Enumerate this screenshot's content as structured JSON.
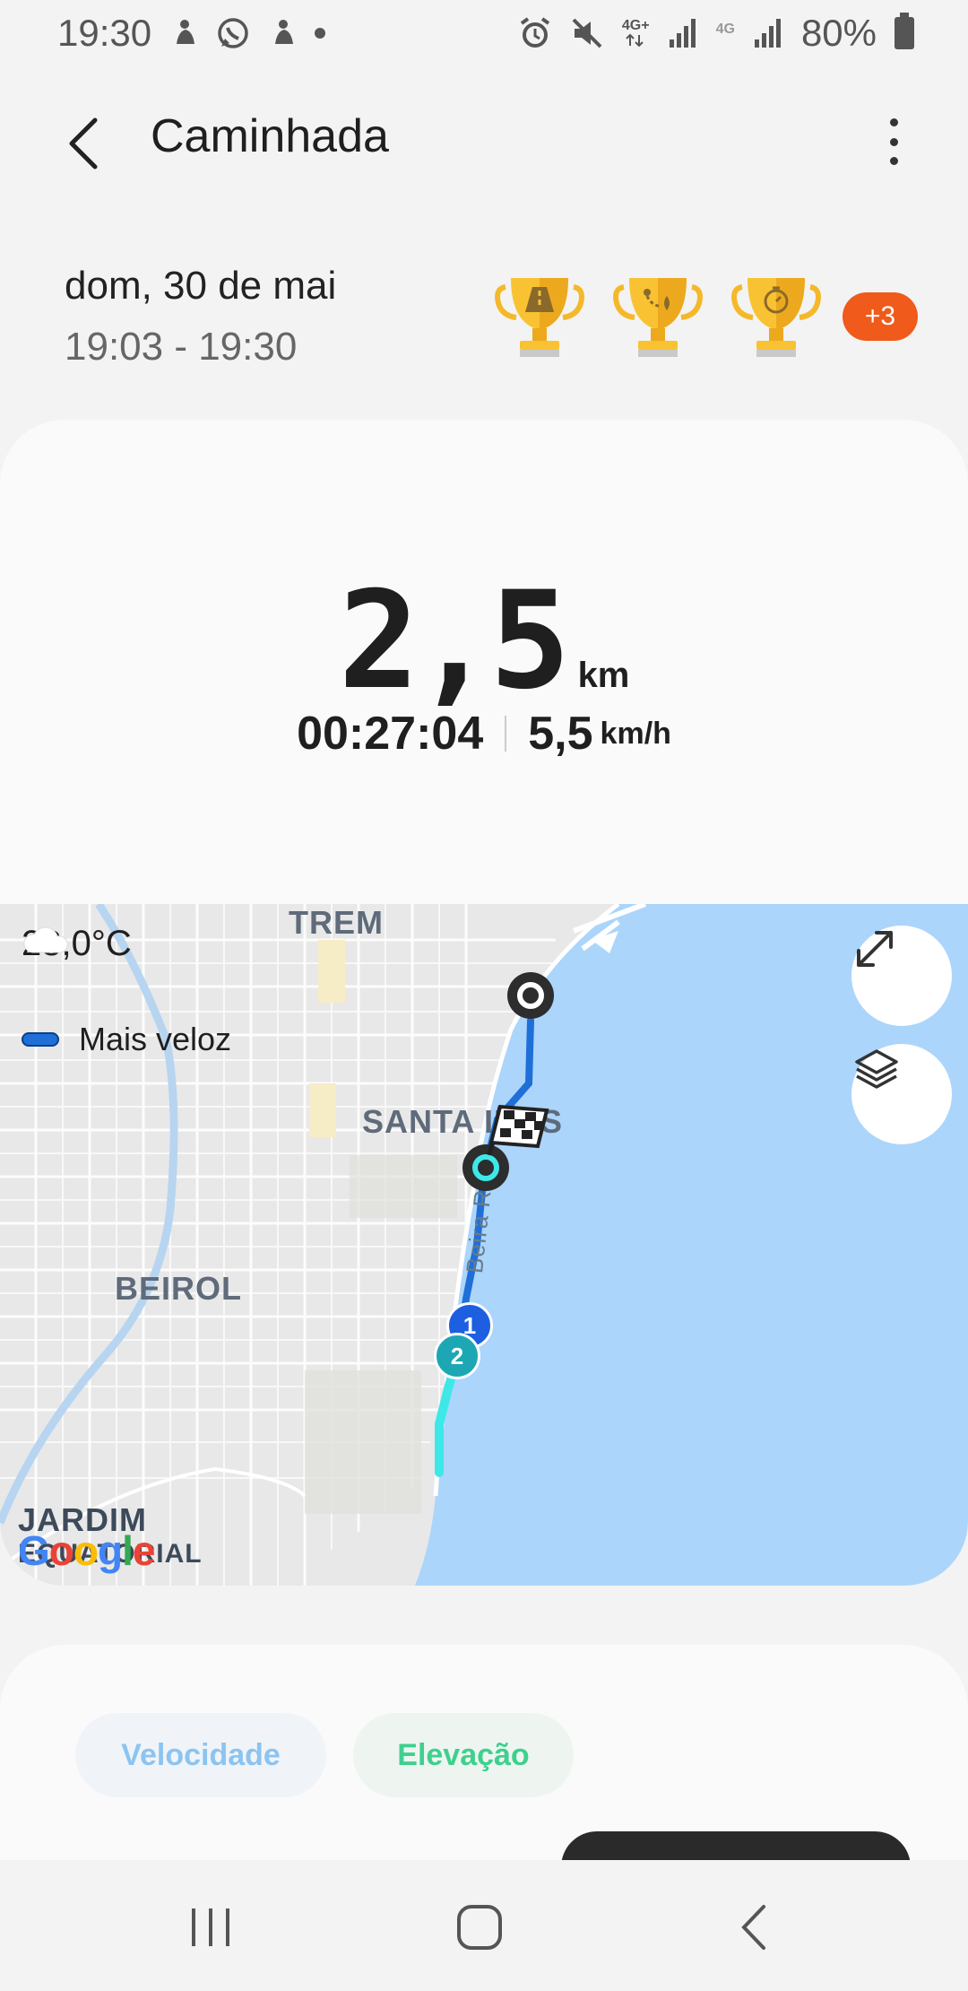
{
  "status_bar": {
    "time": "19:30",
    "network_1": "4G+",
    "network_2": "4G",
    "battery": "80%",
    "icons": [
      "notification-icon",
      "whatsapp-icon",
      "notification-icon",
      "dot-icon",
      "alarm-icon",
      "mute-icon",
      "signal-icon",
      "signal-icon",
      "battery-icon"
    ]
  },
  "header": {
    "title": "Caminhada",
    "back_icon": "back-arrow-icon",
    "menu_icon": "more-vert-icon"
  },
  "session": {
    "date": "dom, 30 de mai",
    "time_range": "19:03 - 19:30",
    "trophies": [
      "trophy-road-icon",
      "trophy-route-icon",
      "trophy-stopwatch-icon"
    ],
    "more_badge": "+3"
  },
  "summary": {
    "distance": "2,5",
    "distance_unit": "km",
    "duration": "00:27:04",
    "speed": "5,5",
    "speed_unit": "km/h"
  },
  "map": {
    "temperature": "28,0°C",
    "legend_label": "Mais veloz",
    "labels": {
      "trem": "TREM",
      "santa_ines": "SANTA INES",
      "beirol": "BEIROL",
      "jardim": "JARDIM",
      "equatorial": "EQUATORIAL",
      "road": "Beira R"
    },
    "markers": {
      "first": "1",
      "second": "2"
    },
    "google": "Google",
    "colors": {
      "water": "#abd5fb",
      "route_fast": "#1f6fd8",
      "route_slow": "#3ee8e8",
      "land": "#e8e8e8"
    }
  },
  "charts": {
    "tab_speed": "Velocidade",
    "tab_elevation": "Elevação"
  }
}
